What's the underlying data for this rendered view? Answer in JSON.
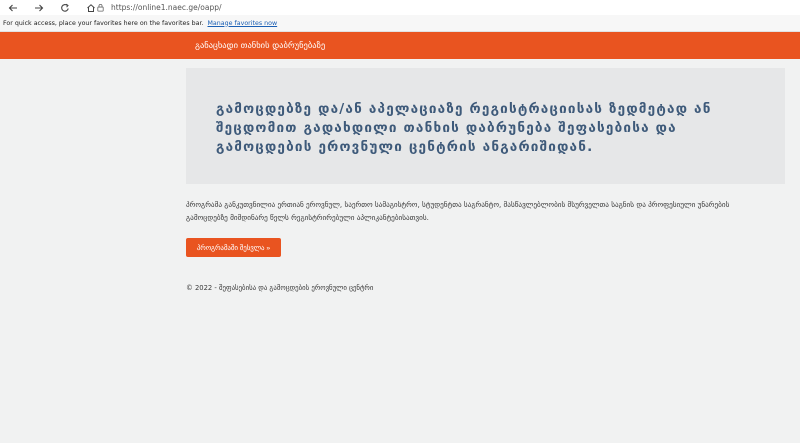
{
  "browser": {
    "url": "https://online1.naec.ge/oapp/",
    "icons": [
      "back-icon",
      "forward-icon",
      "refresh-icon",
      "home-icon",
      "lock-icon"
    ]
  },
  "favorites_bar": {
    "text": "For quick access, place your favorites here on the favorites bar.",
    "manage_link": "Manage favorites now"
  },
  "header": {
    "brand": "განაცხადი თანხის დაბრუნებაზე",
    "color": "#e95420"
  },
  "jumbotron": {
    "title": "გამოცდებზე და/ან აპელაციაზე რეგისტრაციისას ზედმეტად ან შეცდომით გადახდილი თანხის დაბრუნება შეფასებისა და გამოცდების ეროვნული ცენტრის ანგარიშიდან."
  },
  "intro": {
    "text": "პროგრამა განკუთვნილია ერთიან ეროვნულ, საერთო სამაგისტრო, სტუდენტთა საგრანტო, მასწავლებლობის მსურველთა საგნის და პროფესიული უნარების გამოცდებზე მიმდინარე წელს რეგისტრირებული აპლიკანტებისათვის."
  },
  "button": {
    "label": "პროგრამაში შესვლა »"
  },
  "footer": {
    "text": "© 2022 - შეფასებისა და გამოცდების ეროვნული ცენტრი"
  }
}
